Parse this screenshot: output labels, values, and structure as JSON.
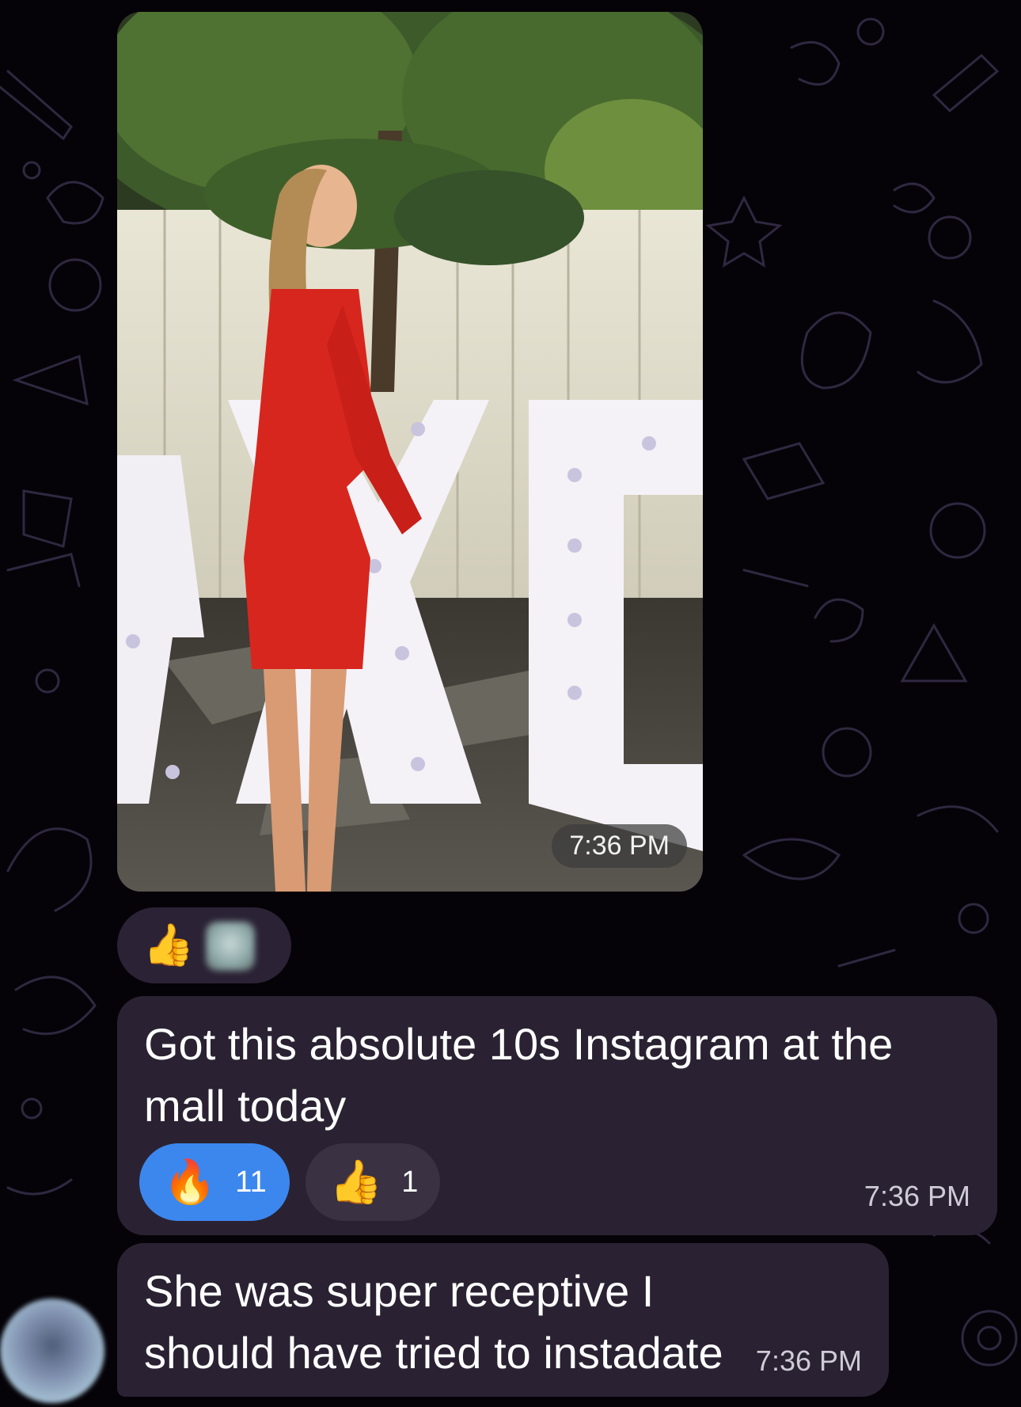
{
  "photo_message": {
    "time": "7:36 PM",
    "reactions": [
      {
        "emoji": "👍",
        "icon": "thumbs-up-icon"
      },
      {
        "emoji": "",
        "icon": "blurred-avatar-icon"
      }
    ]
  },
  "messages": [
    {
      "text": "Got this absolute 10s Instagram at the mall today",
      "time": "7:36 PM",
      "reactions": [
        {
          "emoji": "🔥",
          "icon": "fire-icon",
          "count": "11",
          "selected": true
        },
        {
          "emoji": "👍",
          "icon": "thumbs-up-icon",
          "count": "1",
          "selected": false
        }
      ]
    },
    {
      "text": "She was super receptive I should have tried to instadate",
      "time": "7:36 PM"
    }
  ],
  "colors": {
    "background": "#050308",
    "bubble": "#2a2232",
    "doodle_stroke": "#2f2840",
    "reaction_selected": "#3c87ee",
    "reaction_idle": "#3a3142"
  }
}
